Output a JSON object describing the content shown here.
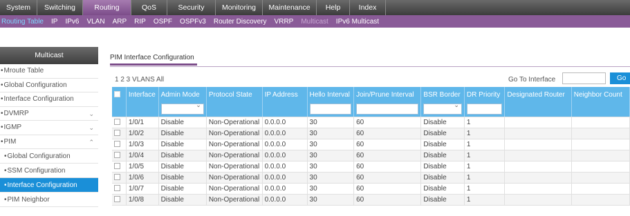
{
  "top_nav": [
    "System",
    "Switching",
    "Routing",
    "QoS",
    "Security",
    "Monitoring",
    "Maintenance",
    "Help",
    "Index"
  ],
  "active_top_nav": "Routing",
  "sub_nav": [
    {
      "label": "Routing Table",
      "style": "hl"
    },
    {
      "label": "IP",
      "style": "normal"
    },
    {
      "label": "IPv6",
      "style": "normal"
    },
    {
      "label": "VLAN",
      "style": "normal"
    },
    {
      "label": "ARP",
      "style": "normal"
    },
    {
      "label": "RIP",
      "style": "normal"
    },
    {
      "label": "OSPF",
      "style": "normal"
    },
    {
      "label": "OSPFv3",
      "style": "normal"
    },
    {
      "label": "Router Discovery",
      "style": "normal"
    },
    {
      "label": "VRRP",
      "style": "normal"
    },
    {
      "label": "Multicast",
      "style": "dim"
    },
    {
      "label": "IPv6 Multicast",
      "style": "normal"
    }
  ],
  "sidebar": {
    "title": "Multicast",
    "items": [
      {
        "label": "Mroute Table",
        "bullet": "•",
        "sub": false,
        "chevron": ""
      },
      {
        "label": "Global Configuration",
        "bullet": "•",
        "sub": false,
        "chevron": ""
      },
      {
        "label": "Interface Configuration",
        "bullet": "•",
        "sub": false,
        "chevron": ""
      },
      {
        "label": "DVMRP",
        "bullet": "•",
        "sub": false,
        "chevron": "⌄"
      },
      {
        "label": "IGMP",
        "bullet": "•",
        "sub": false,
        "chevron": "⌄"
      },
      {
        "label": "PIM",
        "bullet": "•",
        "sub": false,
        "chevron": "⌃"
      },
      {
        "label": "Global Configuration",
        "bullet": "•",
        "sub": true,
        "chevron": ""
      },
      {
        "label": "SSM Configuration",
        "bullet": "•",
        "sub": true,
        "chevron": ""
      },
      {
        "label": "Interface Configuration",
        "bullet": "•",
        "sub": true,
        "chevron": "",
        "active": true
      },
      {
        "label": "PIM Neighbor",
        "bullet": "•",
        "sub": true,
        "chevron": ""
      }
    ]
  },
  "main": {
    "tab": "PIM Interface Configuration",
    "vlans_line": "1 2 3 VLANS All",
    "goto_label": "Go To Interface",
    "go_button": "Go"
  },
  "table": {
    "headers": [
      "Interface",
      "Admin Mode",
      "Protocol State",
      "IP Address",
      "Hello Interval",
      "Join/Prune Interval",
      "BSR Border",
      "DR Priority",
      "Designated Router",
      "Neighbor Count"
    ],
    "rows": [
      [
        "1/0/1",
        "Disable",
        "Non-Operational",
        "0.0.0.0",
        "30",
        "60",
        "Disable",
        "1",
        "",
        ""
      ],
      [
        "1/0/2",
        "Disable",
        "Non-Operational",
        "0.0.0.0",
        "30",
        "60",
        "Disable",
        "1",
        "",
        ""
      ],
      [
        "1/0/3",
        "Disable",
        "Non-Operational",
        "0.0.0.0",
        "30",
        "60",
        "Disable",
        "1",
        "",
        ""
      ],
      [
        "1/0/4",
        "Disable",
        "Non-Operational",
        "0.0.0.0",
        "30",
        "60",
        "Disable",
        "1",
        "",
        ""
      ],
      [
        "1/0/5",
        "Disable",
        "Non-Operational",
        "0.0.0.0",
        "30",
        "60",
        "Disable",
        "1",
        "",
        ""
      ],
      [
        "1/0/6",
        "Disable",
        "Non-Operational",
        "0.0.0.0",
        "30",
        "60",
        "Disable",
        "1",
        "",
        ""
      ],
      [
        "1/0/7",
        "Disable",
        "Non-Operational",
        "0.0.0.0",
        "30",
        "60",
        "Disable",
        "1",
        "",
        ""
      ],
      [
        "1/0/8",
        "Disable",
        "Non-Operational",
        "0.0.0.0",
        "30",
        "60",
        "Disable",
        "1",
        "",
        ""
      ]
    ]
  },
  "colors": {
    "accent_purple": "#7c4d8a",
    "accent_blue": "#1a8fd8",
    "header_blue": "#5fb7ea"
  }
}
